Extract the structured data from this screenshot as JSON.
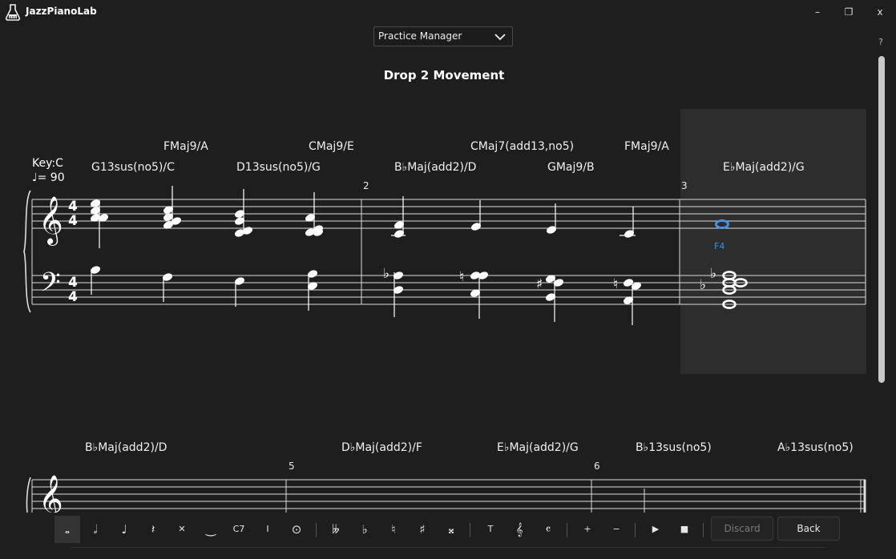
{
  "app": {
    "title": "JazzPianoLab"
  },
  "window_controls": {
    "minimize": "–",
    "restore": "❐",
    "close": "x"
  },
  "help": "?",
  "dropdown": {
    "selected": "Practice Manager"
  },
  "score": {
    "title": "Drop 2 Movement",
    "key": "Key:C",
    "tempo": "♩= 90",
    "chords_upper": [
      {
        "label": "FMaj9/A"
      },
      {
        "label": "CMaj9/E"
      },
      {
        "label": "CMaj7(add13,no5)"
      },
      {
        "label": "FMaj9/A"
      }
    ],
    "chords_lower": [
      {
        "label": "G13sus(no5)/C"
      },
      {
        "label": "D13sus(no5)/G"
      },
      {
        "label": "B♭Maj(add2)/D"
      },
      {
        "label": "GMaj9/B"
      },
      {
        "label": "E♭Maj(add2)/G"
      }
    ],
    "measure_numbers": [
      "2",
      "3",
      "5",
      "6"
    ],
    "selected_note_label": "F4",
    "row2_chords": [
      {
        "label": "B♭Maj(add2)/D"
      },
      {
        "label": "D♭Maj(add2)/F"
      },
      {
        "label": "E♭Maj(add2)/G"
      },
      {
        "label": "B♭13sus(no5)"
      },
      {
        "label": "A♭13sus(no5)"
      }
    ]
  },
  "toolbar": {
    "durations": [
      "𝅝",
      "𝅗𝅥",
      "♩",
      "𝄽",
      "✕",
      "‿",
      "C7",
      "I",
      "⊙"
    ],
    "accidentals": [
      "𝄫",
      "♭",
      "♮",
      "♯",
      "𝄪"
    ],
    "text_tools": [
      "T",
      "𝄞",
      "𝄴"
    ],
    "zoom": [
      "+",
      "−"
    ],
    "transport": [
      "▶",
      "■"
    ],
    "discard": "Discard",
    "back": "Back"
  },
  "colors": {
    "background": "#1e1e1e",
    "accent": "#3d8ee8",
    "selection": "#2d2d2d"
  }
}
